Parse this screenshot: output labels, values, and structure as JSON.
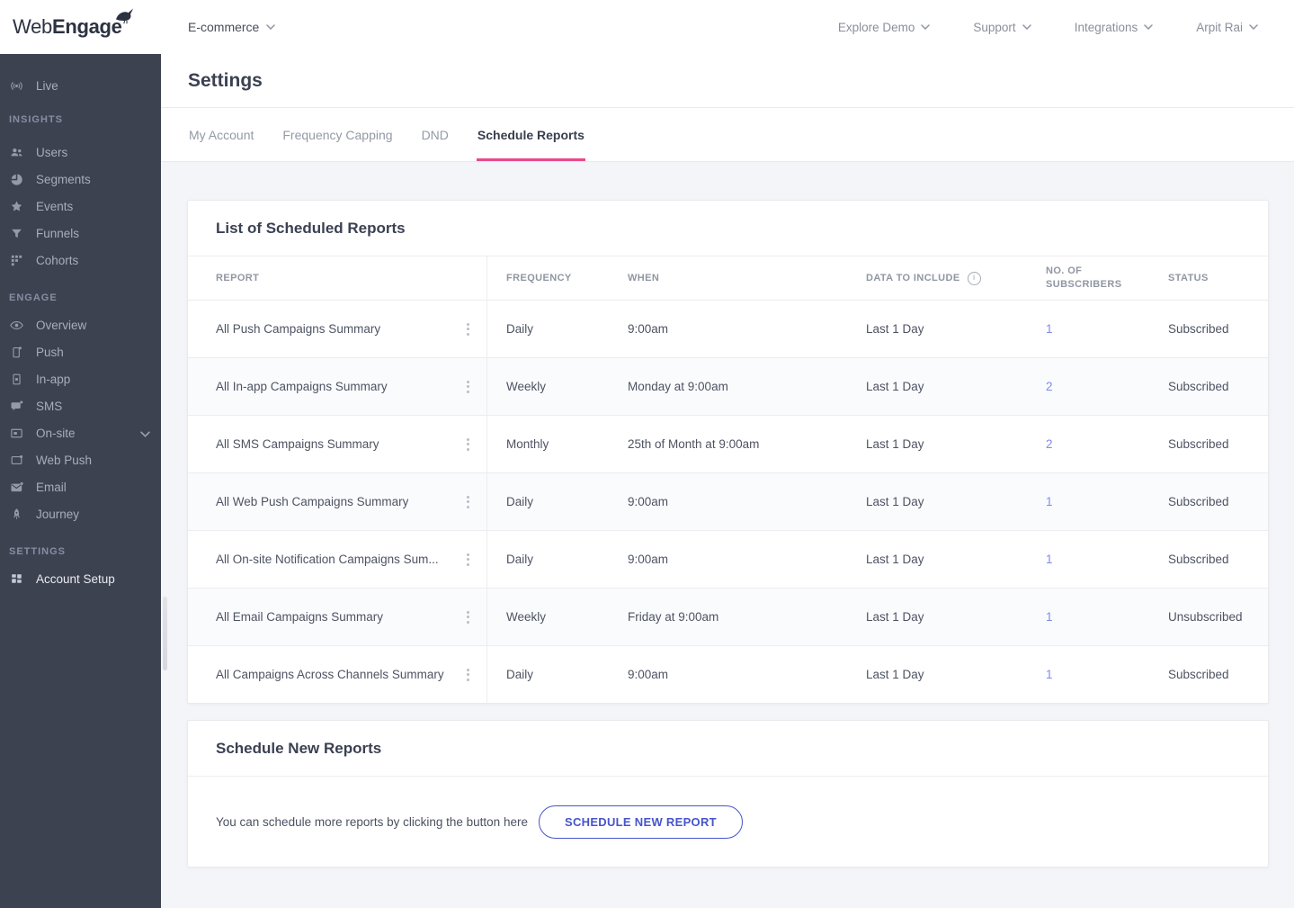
{
  "brand": {
    "web": "Web",
    "engage": "Engage"
  },
  "header": {
    "project": "E-commerce",
    "nav": [
      {
        "label": "Explore Demo"
      },
      {
        "label": "Support"
      },
      {
        "label": "Integrations"
      },
      {
        "label": "Arpit Rai"
      }
    ]
  },
  "sidebar": {
    "live": "Live",
    "sections": [
      {
        "title": "INSIGHTS",
        "items": [
          {
            "label": "Users"
          },
          {
            "label": "Segments"
          },
          {
            "label": "Events"
          },
          {
            "label": "Funnels"
          },
          {
            "label": "Cohorts"
          }
        ]
      },
      {
        "title": "ENGAGE",
        "items": [
          {
            "label": "Overview"
          },
          {
            "label": "Push"
          },
          {
            "label": "In-app"
          },
          {
            "label": "SMS"
          },
          {
            "label": "On-site"
          },
          {
            "label": "Web Push"
          },
          {
            "label": "Email"
          },
          {
            "label": "Journey"
          }
        ]
      },
      {
        "title": "SETTINGS",
        "items": [
          {
            "label": "Account Setup"
          }
        ]
      }
    ]
  },
  "page": {
    "title": "Settings",
    "tabs": [
      {
        "label": "My Account",
        "active": false
      },
      {
        "label": "Frequency Capping",
        "active": false
      },
      {
        "label": "DND",
        "active": false
      },
      {
        "label": "Schedule Reports",
        "active": true
      }
    ]
  },
  "reports": {
    "title": "List of Scheduled Reports",
    "columns": [
      "REPORT",
      "FREQUENCY",
      "WHEN",
      "DATA TO INCLUDE",
      "NO. OF SUBSCRIBERS",
      "STATUS"
    ],
    "rows": [
      {
        "report": "All Push Campaigns Summary",
        "frequency": "Daily",
        "when": "9:00am",
        "data": "Last 1 Day",
        "subscribers": "1",
        "status": "Subscribed"
      },
      {
        "report": "All In-app Campaigns Summary",
        "frequency": "Weekly",
        "when": "Monday at 9:00am",
        "data": "Last 1 Day",
        "subscribers": "2",
        "status": "Subscribed"
      },
      {
        "report": "All SMS Campaigns Summary",
        "frequency": "Monthly",
        "when": "25th of Month at 9:00am",
        "data": "Last 1 Day",
        "subscribers": "2",
        "status": "Subscribed"
      },
      {
        "report": "All Web Push Campaigns Summary",
        "frequency": "Daily",
        "when": "9:00am",
        "data": "Last 1 Day",
        "subscribers": "1",
        "status": "Subscribed"
      },
      {
        "report": "All On-site Notification Campaigns Sum...",
        "frequency": "Daily",
        "when": "9:00am",
        "data": "Last 1 Day",
        "subscribers": "1",
        "status": "Subscribed"
      },
      {
        "report": "All Email Campaigns Summary",
        "frequency": "Weekly",
        "when": "Friday at 9:00am",
        "data": "Last 1 Day",
        "subscribers": "1",
        "status": "Unsubscribed"
      },
      {
        "report": "All Campaigns Across Channels Summary",
        "frequency": "Daily",
        "when": "9:00am",
        "data": "Last 1 Day",
        "subscribers": "1",
        "status": "Subscribed"
      }
    ]
  },
  "schedule": {
    "title": "Schedule New Reports",
    "text": "You can schedule more reports by clicking the button here",
    "button": "SCHEDULE NEW REPORT"
  },
  "colors": {
    "accent_pink": "#e9498a",
    "accent_indigo": "#4754cb",
    "link": "#7f8af0",
    "sidebar_bg": "#3d4251"
  }
}
